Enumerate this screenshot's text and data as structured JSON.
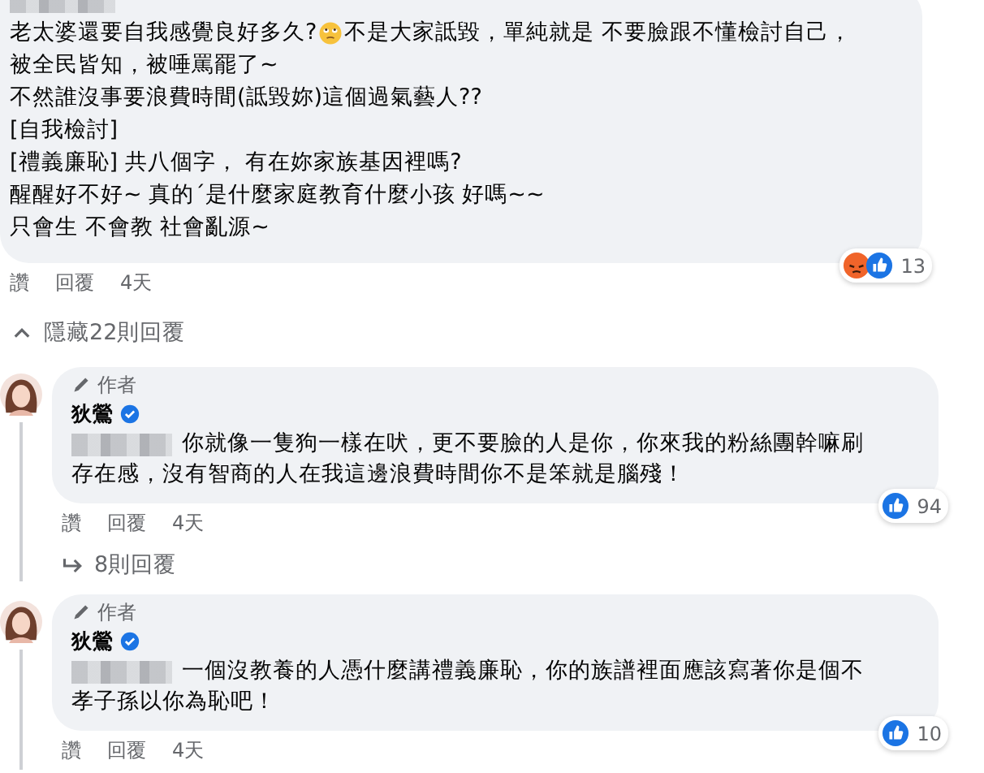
{
  "comment": {
    "lines": [
      {
        "text": "老太婆還要自我感覺良好多久?",
        "emoji": true,
        "text_after": " 不是大家詆毀，單純就是 不要臉跟不懂檢討自己，"
      },
      {
        "text": "被全民皆知，被唾罵罷了~"
      },
      {
        "text": "不然誰沒事要浪費時間(詆毀妳)這個過氣藝人??"
      },
      {
        "text": "[自我檢討]"
      },
      {
        "text": "[禮義廉恥] 共八個字， 有在妳家族基因裡嗎?"
      },
      {
        "text": "醒醒好不好~ 真的´是什麼家庭教育什麼小孩 好嗎~~"
      },
      {
        "text": "只會生 不會教 社會亂源~"
      }
    ],
    "reactions": [
      {
        "kind": "angry"
      },
      {
        "kind": "like"
      }
    ],
    "reaction_count": "13",
    "actions": [
      "讚",
      "回覆",
      "4天"
    ]
  },
  "hide_replies": "隱藏22則回覆",
  "replies": [
    {
      "badge": "作者",
      "author": "狄鶯",
      "verified": true,
      "lines": [
        "你就像一隻狗一樣在吠，更不要臉的人是你，你來我的粉絲團幹嘛刷",
        "存在感，沒有智商的人在我這邊浪費時間你不是笨就是腦殘！"
      ],
      "reactions": [
        {
          "kind": "like"
        }
      ],
      "reaction_count": "94",
      "actions": [
        "讚",
        "回覆",
        "4天"
      ],
      "more_replies": "8則回覆"
    },
    {
      "badge": "作者",
      "author": "狄鶯",
      "verified": true,
      "lines": [
        "一個沒教養的人憑什麼講禮義廉恥，你的族譜裡面應該寫著你是個不",
        "孝子孫以你為恥吧！"
      ],
      "reactions": [
        {
          "kind": "like"
        }
      ],
      "reaction_count": "10",
      "actions": [
        "讚",
        "回覆",
        "4天"
      ]
    }
  ]
}
